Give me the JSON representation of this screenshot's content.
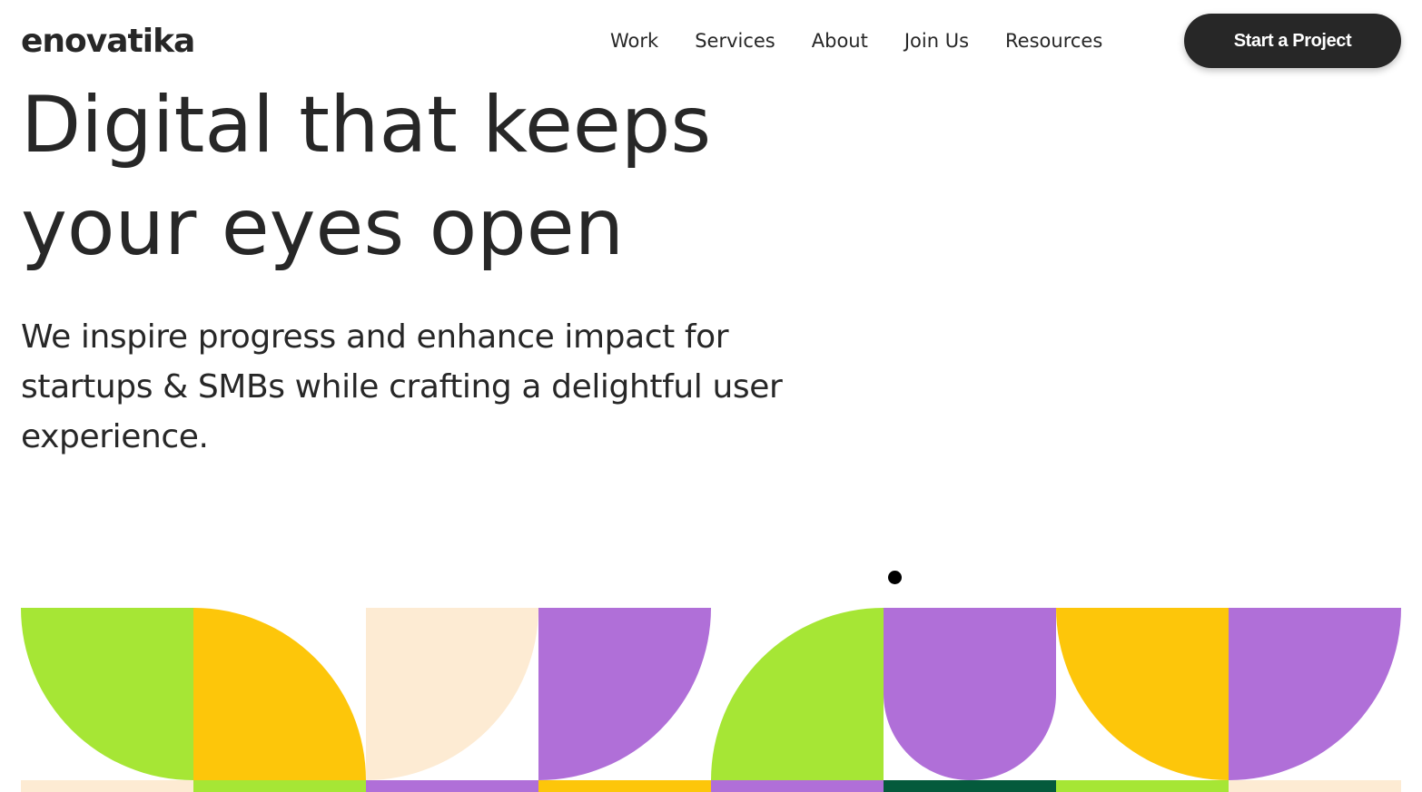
{
  "header": {
    "logo": "enovatika",
    "nav": {
      "work": "Work",
      "services": "Services",
      "about": "About",
      "join_us": "Join Us",
      "resources": "Resources"
    },
    "cta_label": "Start a Project"
  },
  "hero": {
    "title_line1": "Digital that keeps",
    "title_line2": "your eyes open",
    "subtitle": "We inspire progress and enhance impact for startups & SMBs while crafting a delightful user experience."
  },
  "colors": {
    "text": "#272727",
    "lime": "#A6E635",
    "yellow": "#FDC60A",
    "cream": "#FDEBD3",
    "purple": "#B06FD8",
    "dark_green": "#045A3C",
    "button_bg": "#272727"
  },
  "tiles": [
    {
      "color": "#A6E635",
      "shape": "bottom-left",
      "under": "#FDEBD3"
    },
    {
      "color": "#FDC60A",
      "shape": "top-right",
      "under": "#A6E635"
    },
    {
      "color": "#FDEBD3",
      "shape": "bottom-right",
      "under": "#B06FD8"
    },
    {
      "color": "#B06FD8",
      "shape": "bottom-right",
      "under": "#FDC60A"
    },
    {
      "color": "#A6E635",
      "shape": "top-left",
      "under": "#B06FD8"
    },
    {
      "color": "#B06FD8",
      "shape": "half-bottom",
      "under": "#045A3C"
    },
    {
      "color": "#FDC60A",
      "shape": "bottom-left",
      "under": "#A6E635"
    },
    {
      "color": "#B06FD8",
      "shape": "bottom-right",
      "under": "#FDEBD3"
    }
  ]
}
